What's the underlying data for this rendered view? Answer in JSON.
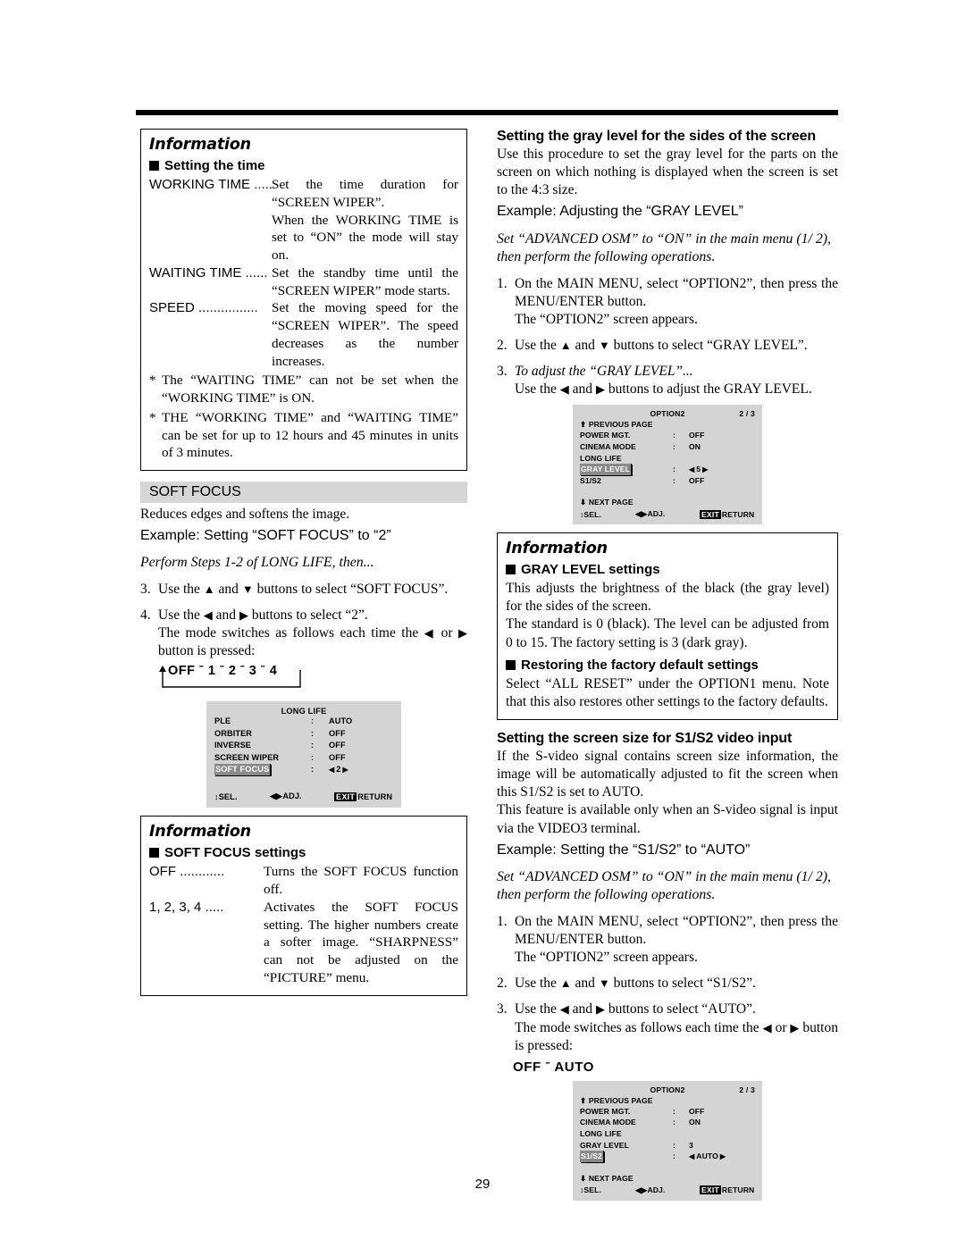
{
  "page_number": "29",
  "left_column": {
    "info_time": {
      "title": "Information",
      "subtitle": "Setting the time",
      "defs": [
        {
          "label": "WORKING TIME .....",
          "text": "Set the time duration for “SCREEN WIPER”.",
          "cont": "When the WORKING TIME is set to “ON” the mode will stay on."
        },
        {
          "label": "WAITING TIME ......",
          "text": "Set the standby time until the “SCREEN WIPER” mode starts.",
          "cont": ""
        },
        {
          "label": "SPEED ................",
          "text": "Set the moving speed for the “SCREEN WIPER”. The speed decreases as the number increases.",
          "cont": ""
        }
      ],
      "notes": [
        "The “WAITING TIME” can not be set when the “WORKING TIME” is ON.",
        "THE “WORKING TIME” and “WAITING TIME” can be set for up to 12 hours and 45 minutes in units of 3 minutes."
      ]
    },
    "section": {
      "bar_label": "SOFT FOCUS",
      "intro": "Reduces edges and softens the image.",
      "example": "Example: Setting “SOFT FOCUS” to “2”",
      "perform": "Perform Steps 1-2 of LONG LIFE, then...",
      "steps": [
        {
          "num": "3.",
          "pre": "Use the ",
          "mid": " and ",
          "post": " buttons to select “SOFT FOCUS”.",
          "up": "▲",
          "down": "▼"
        },
        {
          "num": "4.",
          "pre": "Use the ",
          "mid": " and ",
          "post": " buttons to select “2”.",
          "left": "◀",
          "right": "▶",
          "line2a": "The mode switches as follows each time the ",
          "line2b": " or ",
          "line2c": " button is pressed:"
        }
      ],
      "cycle": "OFF  ˉ  1  ˉ  2  ˉ  3  ˉ  4"
    },
    "osd_long_life": {
      "title": "LONG LIFE",
      "rows": [
        {
          "key": "PLE",
          "colon": ":",
          "value": "AUTO",
          "highlight": false,
          "adjust": false
        },
        {
          "key": "ORBITER",
          "colon": ":",
          "value": "OFF",
          "highlight": false,
          "adjust": false
        },
        {
          "key": "INVERSE",
          "colon": ":",
          "value": "OFF",
          "highlight": false,
          "adjust": false
        },
        {
          "key": "SCREEN WIPER",
          "colon": ":",
          "value": "OFF",
          "highlight": false,
          "adjust": false
        },
        {
          "key": "SOFT FOCUS",
          "colon": ":",
          "value": "2",
          "highlight": true,
          "adjust": true
        }
      ],
      "footer": {
        "sel": "SEL.",
        "adj": "ADJ.",
        "exit": "EXIT",
        "return": "RETURN"
      }
    },
    "info_soft_focus": {
      "title": "Information",
      "subtitle": "SOFT FOCUS settings",
      "defs": [
        {
          "label": "OFF ............",
          "text": "Turns the SOFT FOCUS function off."
        },
        {
          "label": "1, 2, 3, 4 .....",
          "text": "Activates the SOFT FOCUS setting. The higher numbers create a softer image. “SHARPNESS” can not be adjusted  on the “PICTURE” menu."
        }
      ]
    }
  },
  "right_column": {
    "gray_level": {
      "heading": "Setting the gray level for the sides of the screen",
      "body": "Use this procedure to set the gray level for the parts on the screen on which nothing is displayed when the screen is set to the 4:3 size.",
      "example": "Example: Adjusting the “GRAY LEVEL”",
      "osm_note": "Set “ADVANCED OSM” to “ON” in the main menu (1/ 2), then perform the following operations.",
      "steps": [
        {
          "num": "1.",
          "text": "On the MAIN MENU, select “OPTION2”, then press the MENU/ENTER button.",
          "text2": "The “OPTION2” screen appears."
        },
        {
          "num": "2.",
          "pre": "Use the ",
          "mid": " and ",
          "post": " buttons to select “GRAY LEVEL”."
        },
        {
          "num": "3.",
          "ital": "To adjust the “GRAY LEVEL”...",
          "pre": "Use the ",
          "mid": " and ",
          "post": " buttons to adjust the GRAY LEVEL."
        }
      ]
    },
    "osd_option2_a": {
      "title": "OPTION2",
      "page": "2 / 3",
      "prev": "PREVIOUS PAGE",
      "next": "NEXT PAGE",
      "rows": [
        {
          "key": "POWER MGT.",
          "colon": ":",
          "value": "OFF",
          "highlight": false,
          "adjust": false
        },
        {
          "key": "CINEMA MODE",
          "colon": ":",
          "value": "ON",
          "highlight": false,
          "adjust": false
        },
        {
          "key": "LONG LIFE",
          "colon": "",
          "value": "",
          "highlight": false,
          "adjust": false
        },
        {
          "key": "GRAY LEVEL",
          "colon": ":",
          "value": "5",
          "highlight": true,
          "adjust": true
        },
        {
          "key": "S1/S2",
          "colon": ":",
          "value": "OFF",
          "highlight": false,
          "adjust": false
        }
      ],
      "footer": {
        "sel": "SEL.",
        "adj": "ADJ.",
        "exit": "EXIT",
        "return": "RETURN"
      }
    },
    "info_gray": {
      "title": "Information",
      "subtitle1": "GRAY LEVEL settings",
      "body1": "This adjusts the brightness of the black (the gray level) for the sides of the screen.",
      "body2": "The standard is 0 (black). The level can be adjusted from 0 to 15. The factory setting is 3 (dark gray).",
      "subtitle2": "Restoring the factory default settings",
      "body3": "Select “ALL RESET” under the OPTION1 menu. Note that this also restores other settings to the factory defaults."
    },
    "s1s2": {
      "heading": "Setting the screen size for S1/S2 video input",
      "body1": "If the S-video signal contains screen size information, the image will be automatically adjusted to fit the screen when this S1/S2 is set to AUTO.",
      "body2": "This feature is available only when an S-video signal is input via the VIDEO3 terminal.",
      "example": "Example: Setting the “S1/S2” to “AUTO”",
      "osm_note": "Set “ADVANCED OSM” to “ON” in the main menu (1/ 2), then perform the following operations.",
      "steps": [
        {
          "num": "1.",
          "text": "On the MAIN MENU, select “OPTION2”, then press the MENU/ENTER button.",
          "text2": "The “OPTION2” screen appears."
        },
        {
          "num": "2.",
          "pre": "Use the ",
          "mid": " and ",
          "post": " buttons to select “S1/S2”."
        },
        {
          "num": "3.",
          "pre": "Use the ",
          "mid": " and ",
          "post": " buttons to select “AUTO”.",
          "line2a": "The mode switches as follows each time the ",
          "line2b": " or ",
          "line2c": " button is pressed:"
        }
      ],
      "cycle": "OFF ˉ  AUTO"
    },
    "osd_option2_b": {
      "title": "OPTION2",
      "page": "2 / 3",
      "prev": "PREVIOUS PAGE",
      "next": "NEXT PAGE",
      "rows": [
        {
          "key": "POWER MGT.",
          "colon": ":",
          "value": "OFF",
          "highlight": false,
          "adjust": false
        },
        {
          "key": "CINEMA MODE",
          "colon": ":",
          "value": "ON",
          "highlight": false,
          "adjust": false
        },
        {
          "key": "LONG LIFE",
          "colon": "",
          "value": "",
          "highlight": false,
          "adjust": false
        },
        {
          "key": "GRAY LEVEL",
          "colon": ":",
          "value": "3",
          "highlight": false,
          "adjust": false
        },
        {
          "key": "S1/S2",
          "colon": ":",
          "value": "AUTO",
          "highlight": true,
          "adjust": true
        }
      ],
      "footer": {
        "sel": "SEL.",
        "adj": "ADJ.",
        "exit": "EXIT",
        "return": "RETURN"
      }
    }
  },
  "glyphs": {
    "up": "▲",
    "down": "▼",
    "left": "◀",
    "right": "▶",
    "up_small": "⬆",
    "down_small": "⬇",
    "updown": "↕"
  }
}
